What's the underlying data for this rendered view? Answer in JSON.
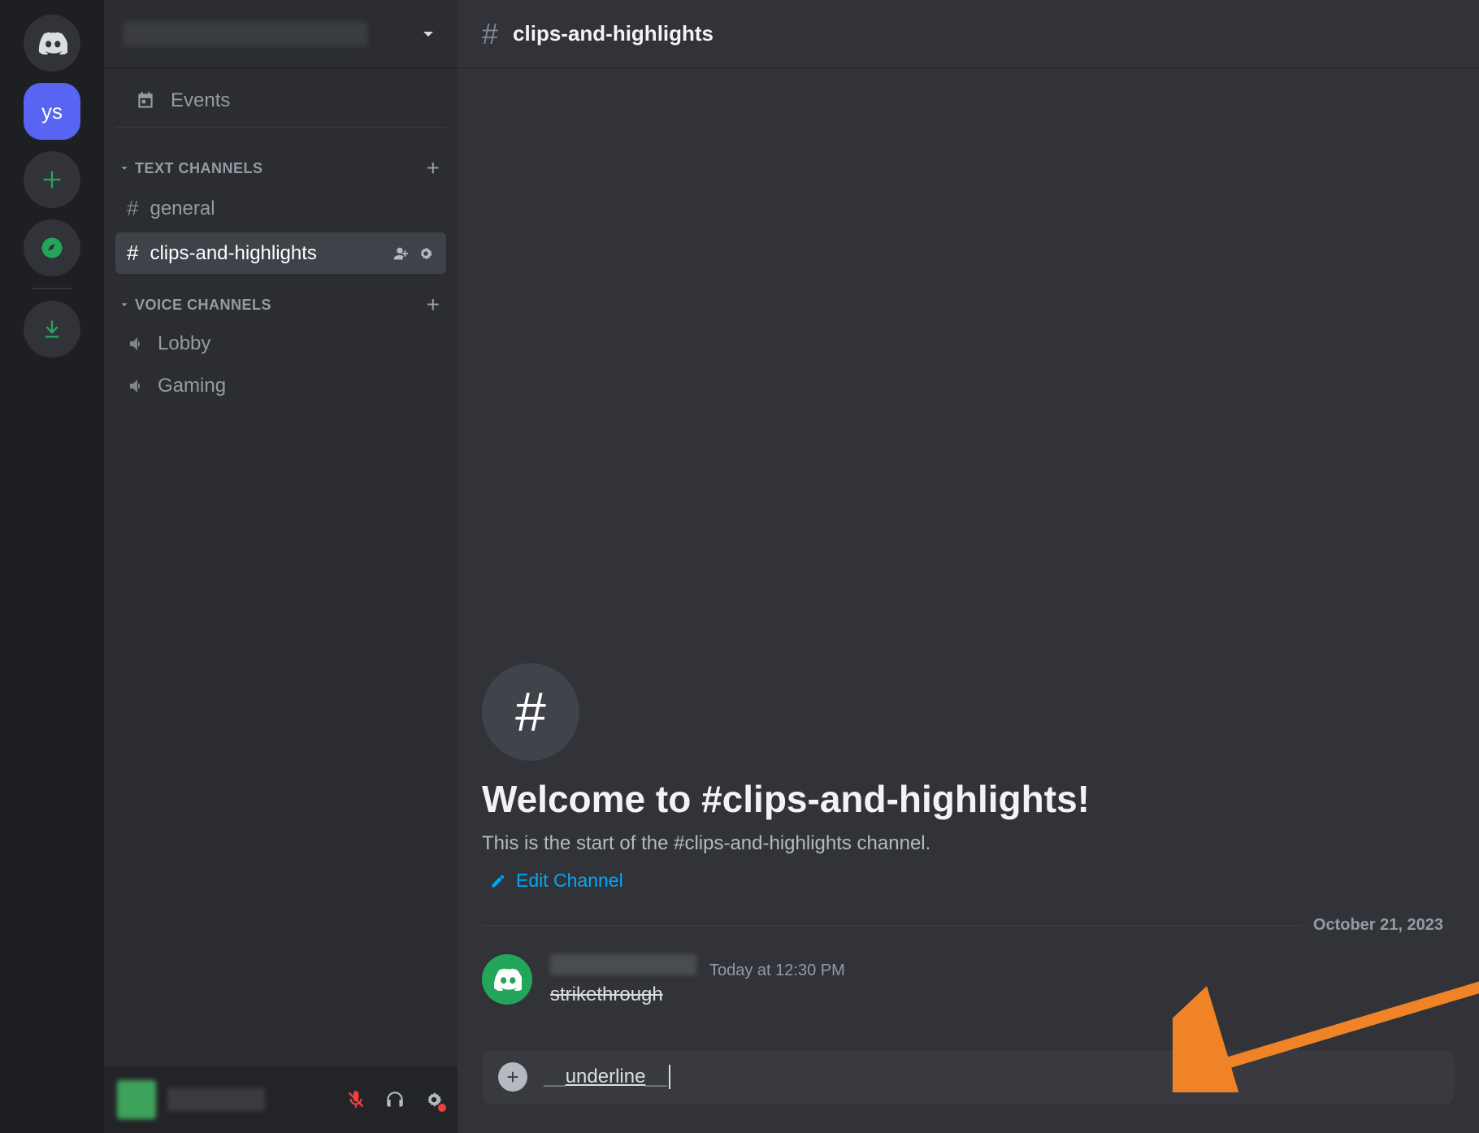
{
  "server_rail": {
    "home_label": "discord-home",
    "selected_server_initials": "ys",
    "add_server_label": "add-server",
    "explore_label": "explore",
    "download_label": "download-apps"
  },
  "server_header": {
    "name_redacted": true
  },
  "events": {
    "label": "Events"
  },
  "categories": {
    "text": {
      "label": "TEXT CHANNELS"
    },
    "voice": {
      "label": "VOICE CHANNELS"
    }
  },
  "channels": {
    "text": [
      {
        "name": "general",
        "active": false
      },
      {
        "name": "clips-and-highlights",
        "active": true
      }
    ],
    "voice": [
      {
        "name": "Lobby"
      },
      {
        "name": "Gaming"
      }
    ]
  },
  "channel_header": {
    "name": "clips-and-highlights"
  },
  "welcome": {
    "title": "Welcome to #clips-and-highlights!",
    "subtitle": "This is the start of the #clips-and-highlights channel.",
    "edit_label": "Edit Channel"
  },
  "divider": {
    "date": "October 21, 2023"
  },
  "message": {
    "author_redacted": true,
    "timestamp": "Today at 12:30 PM",
    "body_text": "strikethrough",
    "body_style": "strikethrough"
  },
  "composer": {
    "raw_prefix": "__",
    "text": "underline",
    "raw_suffix": "__"
  },
  "user_panel": {
    "name_redacted": true,
    "mic_muted": true
  },
  "colors": {
    "blurple": "#5865f2",
    "green": "#23a55a",
    "link": "#00a8fc",
    "arrow": "#f08327"
  }
}
